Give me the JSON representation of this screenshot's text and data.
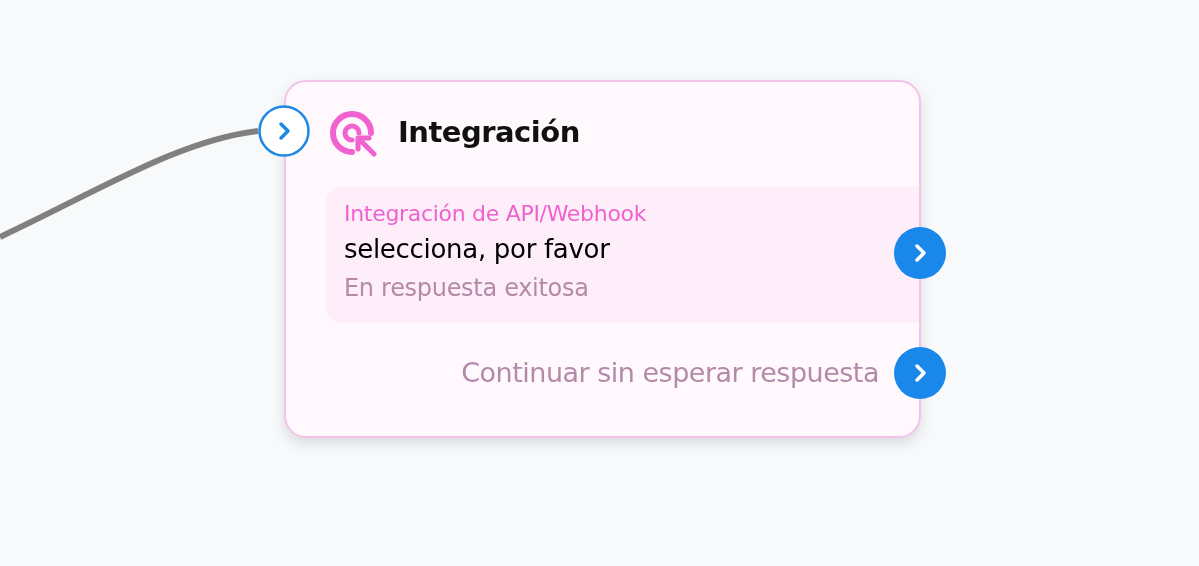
{
  "node": {
    "title": "Integración",
    "action": {
      "label": "Integración de API/Webhook",
      "value": "selecciona, por favor",
      "outcome": "En respuesta exitosa"
    },
    "fallback": "Continuar sin esperar respuesta"
  }
}
